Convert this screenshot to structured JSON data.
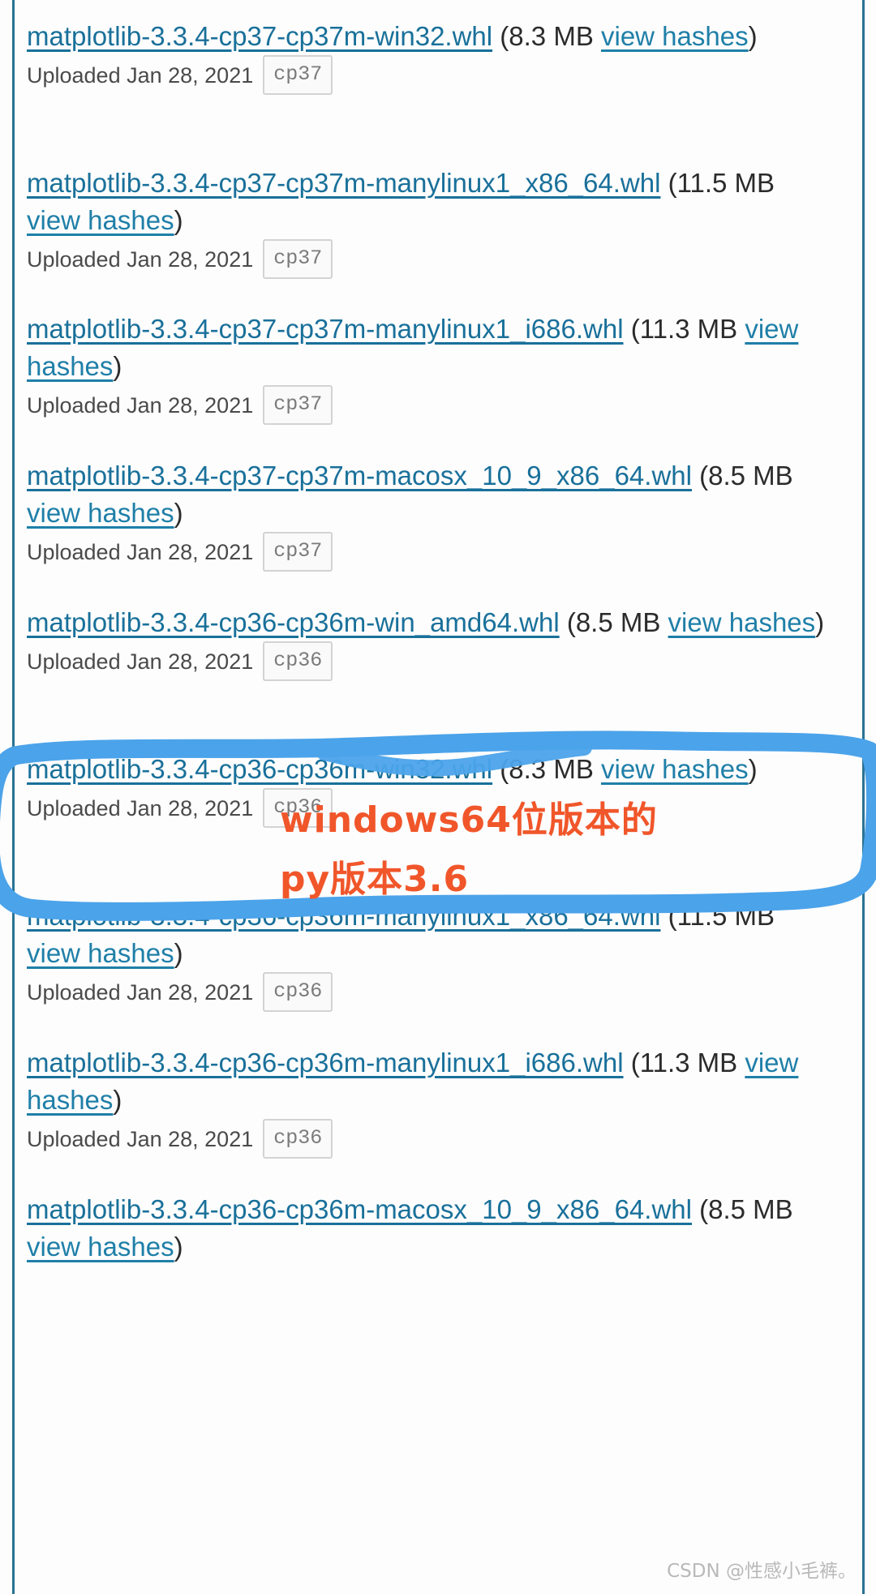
{
  "colors": {
    "link": "#19709a",
    "hash_link": "#1f7fa8",
    "body_text": "#2b2b2b",
    "meta_text": "#4a4a4a",
    "tag_text": "#7b7b7b",
    "tag_bg": "#fafafa",
    "tag_border": "#d3d3d3",
    "page_rule": "#2a7294",
    "highlight_blue": "#4ba3ea",
    "annotation_orange": "#f0562a",
    "watermark": "#b9b9b9"
  },
  "labels": {
    "uploaded_prefix": "Uploaded",
    "view_hashes": "view hashes",
    "open_paren": "(",
    "close_paren": ")"
  },
  "files": [
    {
      "filename": "matplotlib-3.3.4-cp37-cp37m-win32.whl",
      "size": "8.3 MB",
      "hashes_label": "view hashes",
      "uploaded": "Uploaded Jan 28, 2021",
      "python_tag": "cp37",
      "highlighted": false
    },
    {
      "filename": "matplotlib-3.3.4-cp37-cp37m-manylinux1_x86_64.whl",
      "size": "11.5 MB",
      "hashes_label": "view hashes",
      "uploaded": "Uploaded Jan 28, 2021",
      "python_tag": "cp37",
      "highlighted": false
    },
    {
      "filename": "matplotlib-3.3.4-cp37-cp37m-manylinux1_i686.whl",
      "size": "11.3 MB",
      "hashes_label": "view hashes",
      "uploaded": "Uploaded Jan 28, 2021",
      "python_tag": "cp37",
      "highlighted": false
    },
    {
      "filename": "matplotlib-3.3.4-cp37-cp37m-macosx_10_9_x86_64.whl",
      "size": "8.5 MB",
      "hashes_label": "view hashes",
      "uploaded": "Uploaded Jan 28, 2021",
      "python_tag": "cp37",
      "highlighted": false
    },
    {
      "filename": "matplotlib-3.3.4-cp36-cp36m-win_amd64.whl",
      "size": "8.5 MB",
      "hashes_label": "view hashes",
      "uploaded": "Uploaded Jan 28, 2021",
      "python_tag": "cp36",
      "highlighted": true
    },
    {
      "filename": "matplotlib-3.3.4-cp36-cp36m-win32.whl",
      "size": "8.3 MB",
      "hashes_label": "view hashes",
      "uploaded": "Uploaded Jan 28, 2021",
      "python_tag": "cp36",
      "highlighted": false
    },
    {
      "filename": "matplotlib-3.3.4-cp36-cp36m-manylinux1_x86_64.whl",
      "size": "11.5 MB",
      "hashes_label": "view hashes",
      "uploaded": "Uploaded Jan 28, 2021",
      "python_tag": "cp36",
      "highlighted": false
    },
    {
      "filename": "matplotlib-3.3.4-cp36-cp36m-manylinux1_i686.whl",
      "size": "11.3 MB",
      "hashes_label": "view hashes",
      "uploaded": "Uploaded Jan 28, 2021",
      "python_tag": "cp36",
      "highlighted": false
    },
    {
      "filename": "matplotlib-3.3.4-cp36-cp36m-macosx_10_9_x86_64.whl",
      "size": "8.5 MB",
      "hashes_label": "view hashes",
      "uploaded": "",
      "python_tag": "",
      "highlighted": false
    }
  ],
  "annotations": {
    "orange_line_1": "windows64位版本的",
    "orange_line_2": "py版本3.6",
    "highlight_target_filename": "matplotlib-3.3.4-cp36-cp36m-win_amd64.whl"
  },
  "watermark": {
    "text": "CSDN @性感小毛裤。"
  }
}
